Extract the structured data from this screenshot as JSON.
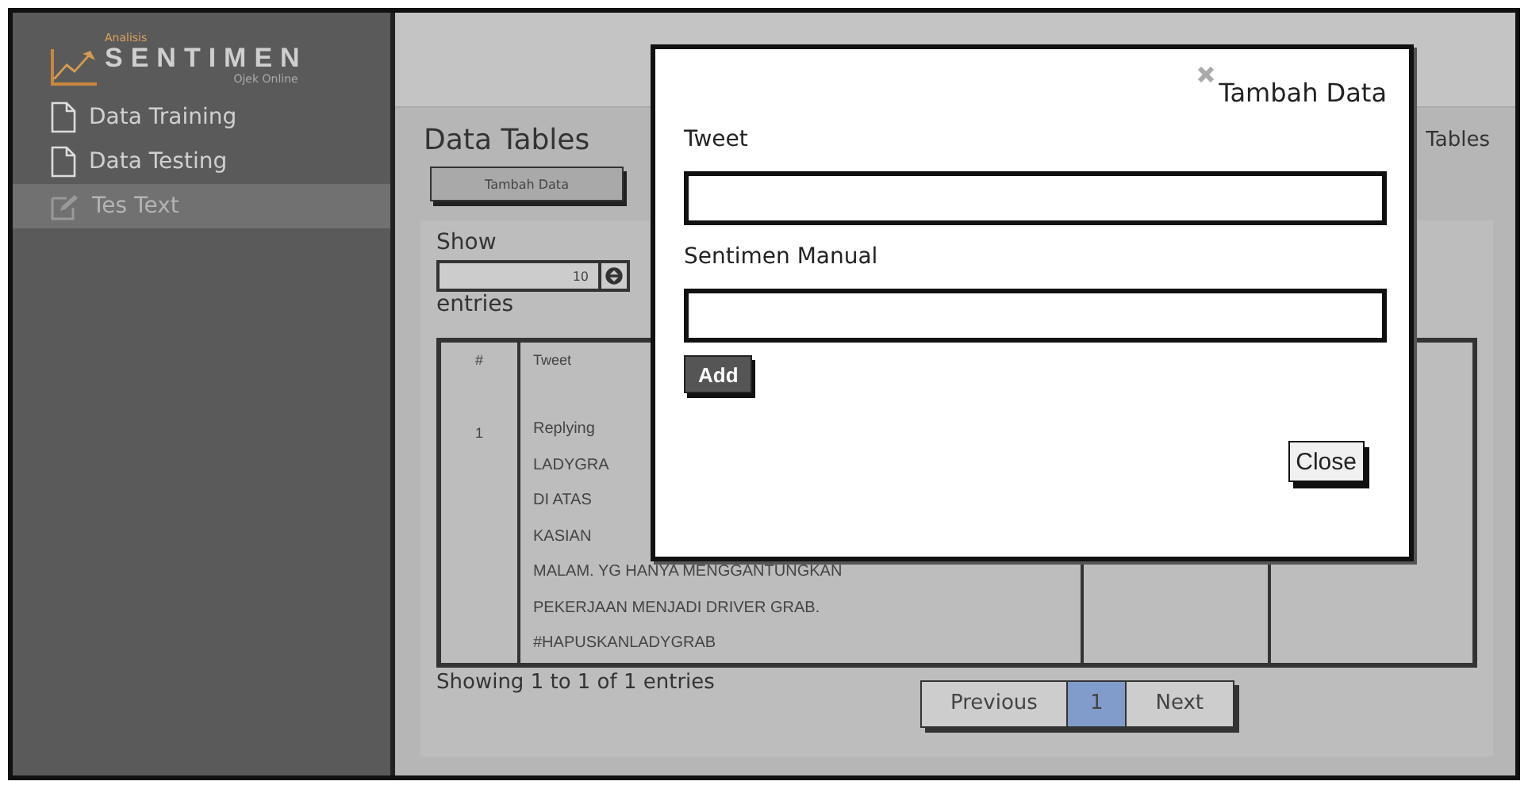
{
  "sidebar": {
    "logo": {
      "top": "Analisis",
      "name": "SENTIMEN",
      "sub": "Ojek Online"
    },
    "items": [
      {
        "label": "Data Training",
        "kind": "document",
        "selected": false
      },
      {
        "label": "Data Testing",
        "kind": "document",
        "selected": false
      },
      {
        "label": "Tes Text",
        "kind": "editor",
        "selected": true
      }
    ]
  },
  "page": {
    "title": "Data Tables",
    "breadcrumb": "Tables",
    "add_button": "Tambah Data"
  },
  "table_panel": {
    "show_label": "Show",
    "page_size": "10",
    "entries_label": "entries",
    "columns": [
      "#",
      "Tweet"
    ],
    "rows": [
      {
        "number": "1",
        "tweet_lines": [
          "Replying",
          "LADYGRA",
          "DI ATAS",
          "KASIAN",
          "MALAM. YG HANYA MENGGANTUNGKAN",
          "PEKERJAAN MENJADI DRIVER GRAB.",
          "#HAPUSKANLADYGRAB"
        ]
      }
    ],
    "info": "Showing 1 to 1 of 1 entries",
    "pagination": {
      "previous": "Previous",
      "pages": [
        {
          "label": "1",
          "selected": true
        }
      ],
      "next": "Next"
    }
  },
  "modal": {
    "title": "Tambah Data",
    "fields": [
      {
        "label": "Tweet"
      },
      {
        "label": "Sentimen Manual"
      }
    ],
    "add_button": "Add",
    "close_button": "Close"
  }
}
